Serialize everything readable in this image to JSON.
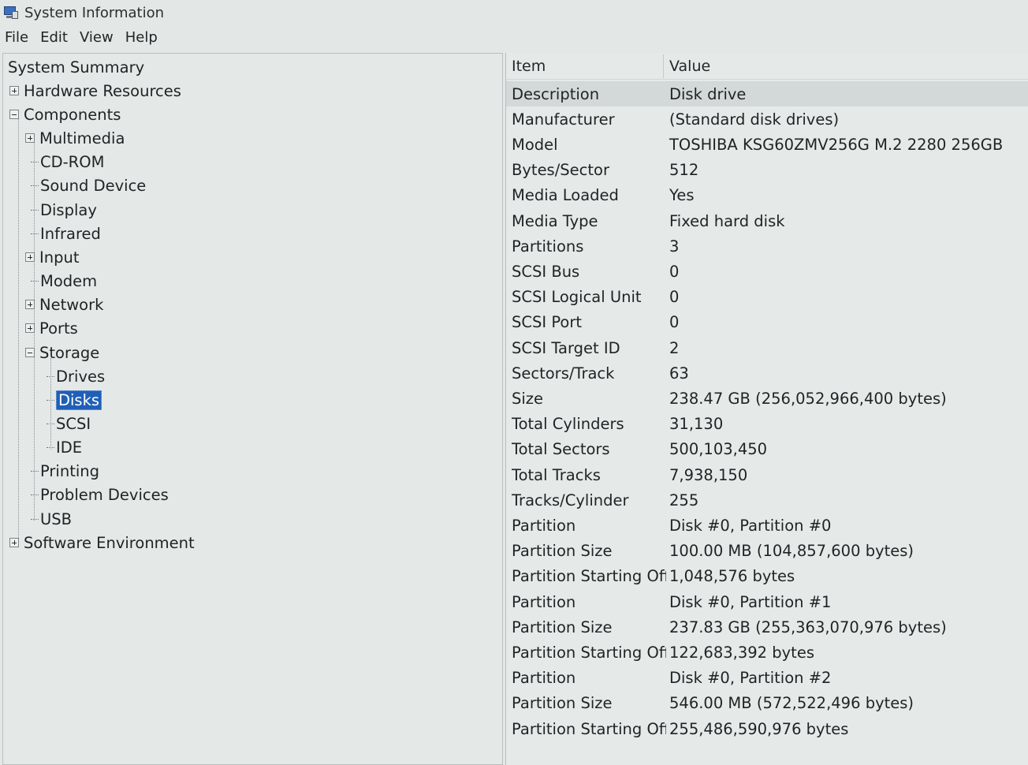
{
  "window": {
    "title": "System Information",
    "icon": "system-info-icon"
  },
  "menu": [
    "File",
    "Edit",
    "View",
    "Help"
  ],
  "tree": [
    {
      "label": "System Summary",
      "expander": "none"
    },
    {
      "label": "Hardware Resources",
      "expander": "plus"
    },
    {
      "label": "Components",
      "expander": "minus"
    },
    {
      "label": "Multimedia",
      "expander": "plus"
    },
    {
      "label": "CD-ROM",
      "expander": "leaf"
    },
    {
      "label": "Sound Device",
      "expander": "leaf"
    },
    {
      "label": "Display",
      "expander": "leaf"
    },
    {
      "label": "Infrared",
      "expander": "leaf"
    },
    {
      "label": "Input",
      "expander": "plus"
    },
    {
      "label": "Modem",
      "expander": "leaf"
    },
    {
      "label": "Network",
      "expander": "plus"
    },
    {
      "label": "Ports",
      "expander": "plus"
    },
    {
      "label": "Storage",
      "expander": "minus"
    },
    {
      "label": "Drives",
      "expander": "leaf"
    },
    {
      "label": "Disks",
      "expander": "leaf",
      "selected": true
    },
    {
      "label": "SCSI",
      "expander": "leaf"
    },
    {
      "label": "IDE",
      "expander": "leaf"
    },
    {
      "label": "Printing",
      "expander": "leaf"
    },
    {
      "label": "Problem Devices",
      "expander": "leaf"
    },
    {
      "label": "USB",
      "expander": "leaf"
    },
    {
      "label": "Software Environment",
      "expander": "plus"
    }
  ],
  "table": {
    "headers": {
      "item": "Item",
      "value": "Value"
    },
    "rows": [
      {
        "item": "Description",
        "value": "Disk drive"
      },
      {
        "item": "Manufacturer",
        "value": "(Standard disk drives)"
      },
      {
        "item": "Model",
        "value": "TOSHIBA KSG60ZMV256G M.2 2280 256GB"
      },
      {
        "item": "Bytes/Sector",
        "value": "512"
      },
      {
        "item": "Media Loaded",
        "value": "Yes"
      },
      {
        "item": "Media Type",
        "value": "Fixed hard disk"
      },
      {
        "item": "Partitions",
        "value": "3"
      },
      {
        "item": "SCSI Bus",
        "value": "0"
      },
      {
        "item": "SCSI Logical Unit",
        "value": "0"
      },
      {
        "item": "SCSI Port",
        "value": "0"
      },
      {
        "item": "SCSI Target ID",
        "value": "2"
      },
      {
        "item": "Sectors/Track",
        "value": "63"
      },
      {
        "item": "Size",
        "value": "238.47 GB (256,052,966,400 bytes)"
      },
      {
        "item": "Total Cylinders",
        "value": "31,130"
      },
      {
        "item": "Total Sectors",
        "value": "500,103,450"
      },
      {
        "item": "Total Tracks",
        "value": "7,938,150"
      },
      {
        "item": "Tracks/Cylinder",
        "value": "255"
      },
      {
        "item": "Partition",
        "value": "Disk #0, Partition #0"
      },
      {
        "item": "Partition Size",
        "value": "100.00 MB (104,857,600 bytes)"
      },
      {
        "item": "Partition Starting Off...",
        "value": "1,048,576 bytes"
      },
      {
        "item": "Partition",
        "value": "Disk #0, Partition #1"
      },
      {
        "item": "Partition Size",
        "value": "237.83 GB (255,363,070,976 bytes)"
      },
      {
        "item": "Partition Starting Off...",
        "value": "122,683,392 bytes"
      },
      {
        "item": "Partition",
        "value": "Disk #0, Partition #2"
      },
      {
        "item": "Partition Size",
        "value": "546.00 MB (572,522,496 bytes)"
      },
      {
        "item": "Partition Starting Off...",
        "value": "255,486,590,976 bytes"
      }
    ]
  }
}
